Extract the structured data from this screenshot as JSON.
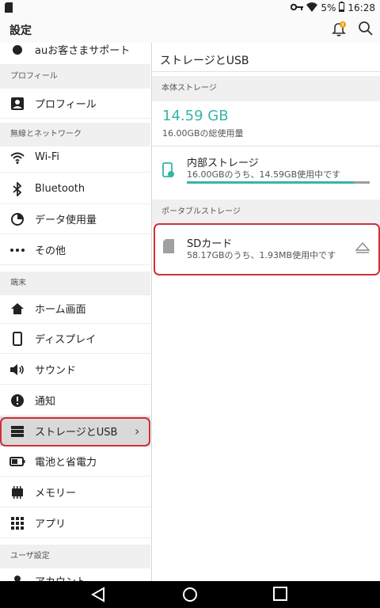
{
  "status": {
    "battery": "5%",
    "time": "16:28"
  },
  "appbar": {
    "title": "設定"
  },
  "left": {
    "partial_item": "auお客さまサポート",
    "sections": [
      "プロフィール",
      "無線とネットワーク",
      "端末",
      "ユーザ設定"
    ],
    "items": [
      {
        "label": "プロフィール"
      },
      {
        "label": "Wi-Fi"
      },
      {
        "label": "Bluetooth"
      },
      {
        "label": "データ使用量"
      },
      {
        "label": "その他"
      },
      {
        "label": "ホーム画面"
      },
      {
        "label": "ディスプレイ"
      },
      {
        "label": "サウンド"
      },
      {
        "label": "通知"
      },
      {
        "label": "ストレージとUSB"
      },
      {
        "label": "電池と省電力"
      },
      {
        "label": "メモリー"
      },
      {
        "label": "アプリ"
      },
      {
        "label": "アカウント"
      }
    ]
  },
  "right": {
    "title": "ストレージとUSB",
    "internal_section": "本体ストレージ",
    "used_total": "14.59 GB",
    "used_total_sub": "16.00GBの総使用量",
    "internal_title": "内部ストレージ",
    "internal_sub": "16.00GBのうち、14.59GB使用中です",
    "internal_fraction": 0.912,
    "portable_section": "ポータブルストレージ",
    "sd_title": "SDカード",
    "sd_sub": "58.17GBのうち、1.93MB使用中です"
  },
  "colors": {
    "accent": "#35b5a6",
    "highlight": "#d0303a",
    "notification_badge": "#f39c12"
  }
}
